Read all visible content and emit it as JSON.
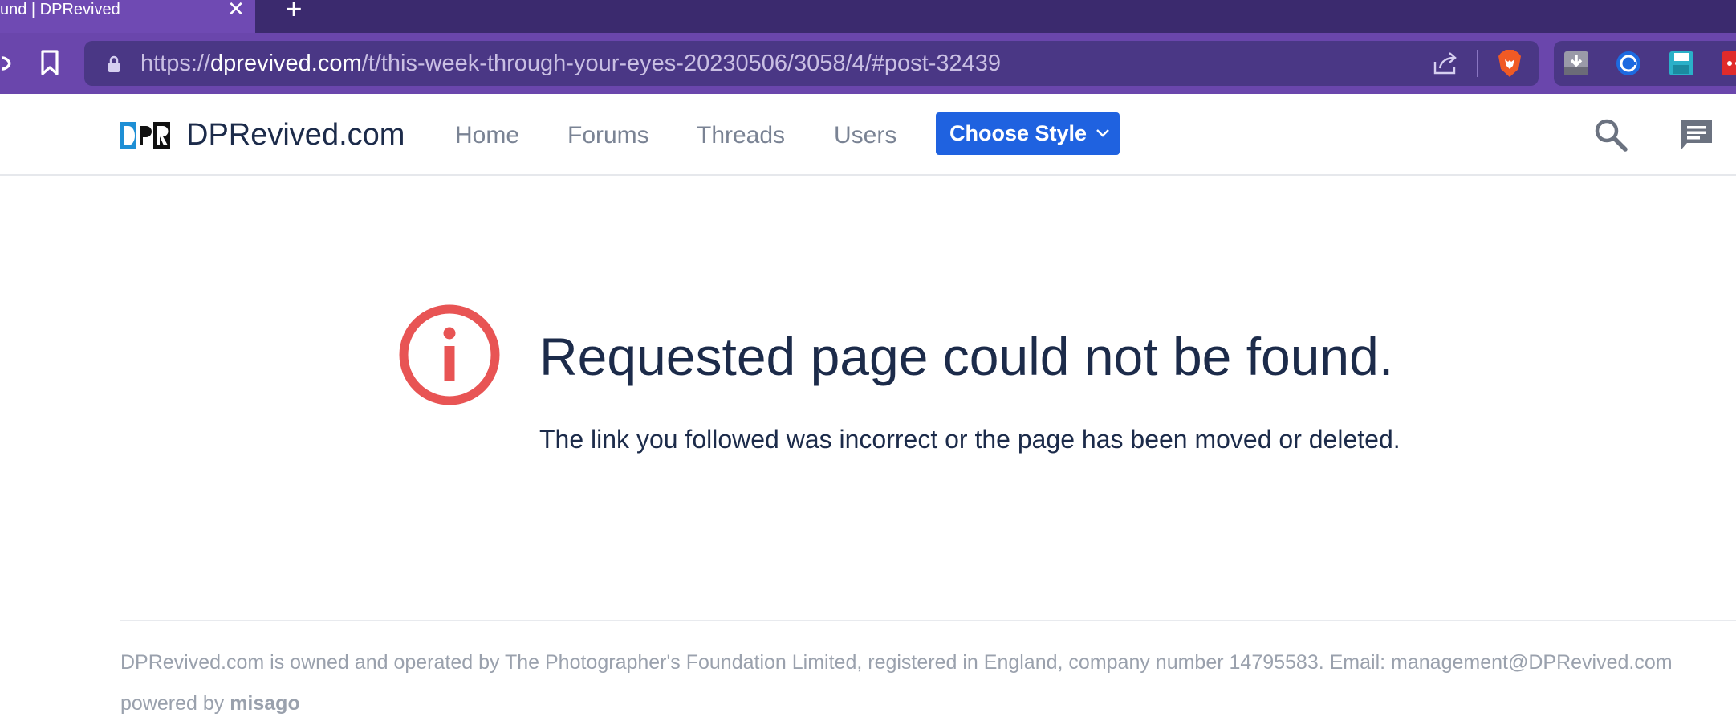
{
  "browser": {
    "tab": {
      "title": "und | DPRevived",
      "close_glyph": "✕"
    },
    "new_tab_glyph": "+",
    "url": {
      "scheme": "https://",
      "host": "dprevived.com",
      "path": "/t/this-week-through-your-eyes-20230506/3058/4/#post-32439"
    },
    "icons": [
      "reload-icon",
      "bookmark-icon",
      "lock-icon",
      "share-icon",
      "brave-shields-icon",
      "download-extension-icon",
      "blue-extension-icon",
      "save-extension-icon",
      "red-extension-icon"
    ]
  },
  "header": {
    "brand": "DPRevived.com",
    "logo_text": "DPR",
    "nav": [
      {
        "label": "Home"
      },
      {
        "label": "Forums"
      },
      {
        "label": "Threads"
      },
      {
        "label": "Users"
      }
    ],
    "style_button": "Choose Style",
    "colors": {
      "accent": "#1f62e0",
      "brand_text": "#1c2b4a",
      "logo_blue": "#1e8fd5"
    }
  },
  "error": {
    "title": "Requested page could not be found.",
    "message": "The link you followed was incorrect or the page has been moved or deleted.",
    "icon_color": "#e85454"
  },
  "footer": {
    "ownership": "DPRevived.com is owned and operated by The Photographer's Foundation Limited, registered in England, company number 14795583. Email: management@DPRevived.com",
    "powered_prefix": "powered by",
    "powered_name": "misago"
  }
}
